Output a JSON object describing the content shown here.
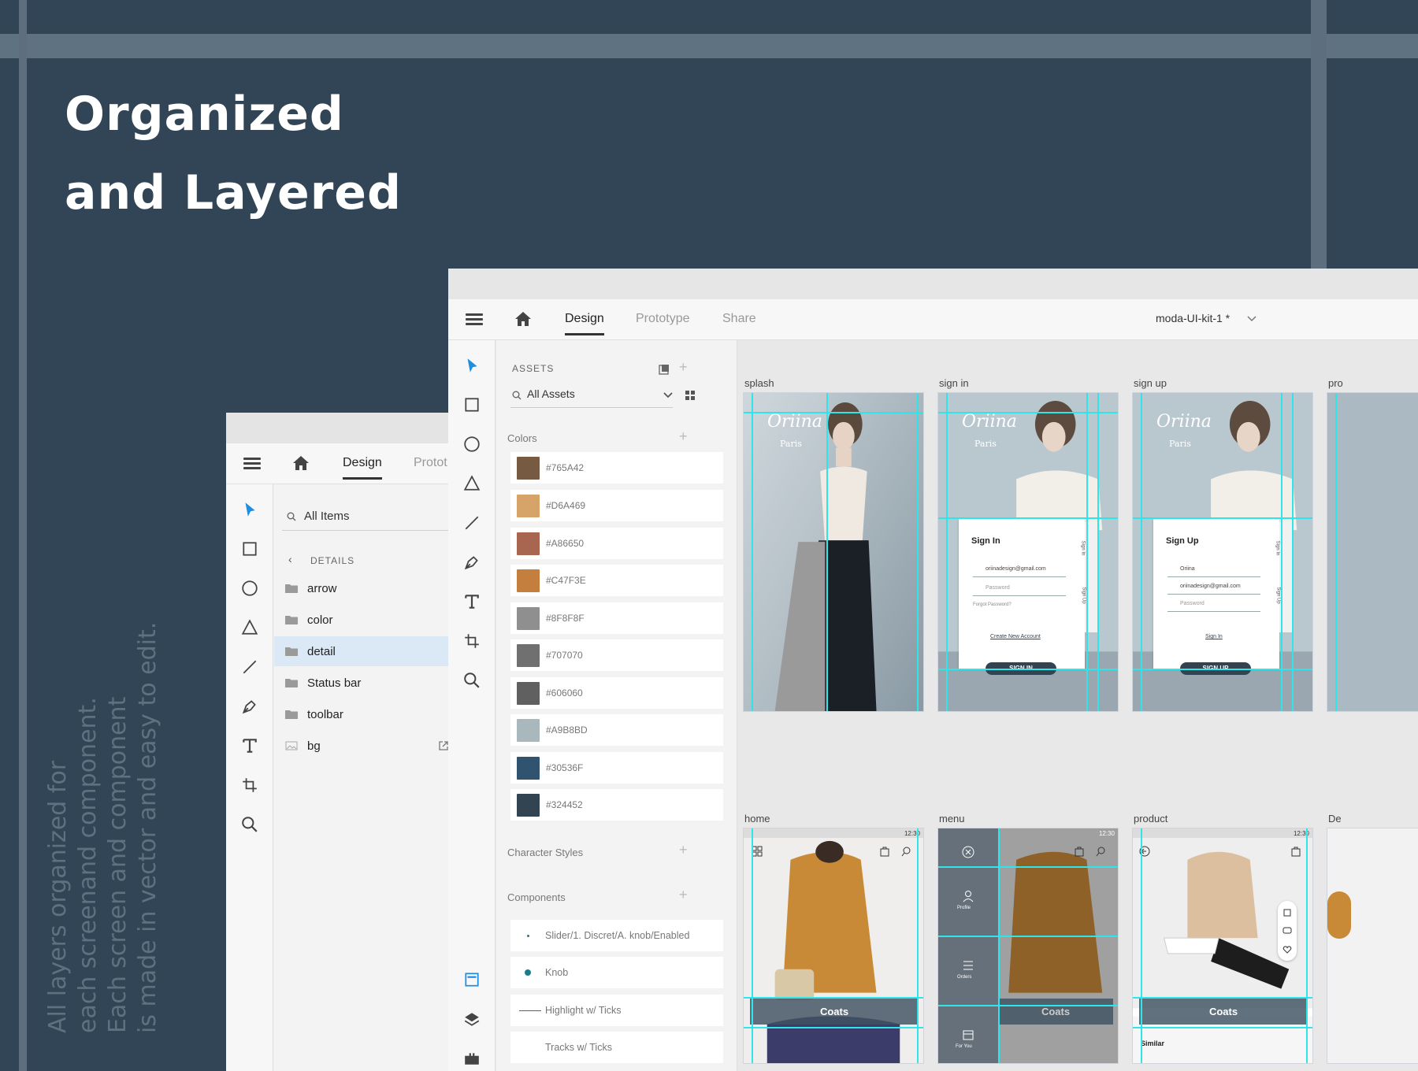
{
  "headline": {
    "line1": "Organized",
    "line2": "and Layered"
  },
  "caption": {
    "lines": [
      "All layers organized for",
      "each screenand component.",
      "Each screen and component",
      "is made in vector and easy to edit."
    ]
  },
  "back_window": {
    "tabs": {
      "design": "Design",
      "prototype": "Protot"
    },
    "search_label": "All Items",
    "details_label": "DETAILS",
    "items": [
      {
        "label": "arrow",
        "icon": "folder-icon"
      },
      {
        "label": "color",
        "icon": "folder-icon"
      },
      {
        "label": "detail",
        "icon": "folder-icon",
        "selected": true
      },
      {
        "label": "Status bar",
        "icon": "folder-icon"
      },
      {
        "label": "toolbar",
        "icon": "folder-icon"
      },
      {
        "label": "bg",
        "icon": "image-icon"
      }
    ]
  },
  "front_window": {
    "tabs": {
      "design": "Design",
      "prototype": "Prototype",
      "share": "Share"
    },
    "document_title": "moda-UI-kit-1 *",
    "assets": {
      "header": "ASSETS",
      "filter": "All Assets",
      "colors_title": "Colors",
      "colors": [
        "#765A42",
        "#D6A469",
        "#A86650",
        "#C47F3E",
        "#8F8F8F",
        "#707070",
        "#606060",
        "#A9B8BD",
        "#30536F",
        "#324452"
      ],
      "character_styles_title": "Character Styles",
      "components_title": "Components",
      "components": [
        {
          "label": "Slider/1. Discret/A. knob/Enabled",
          "icon": "slider-dot-icon"
        },
        {
          "label": "Knob",
          "icon": "knob-icon"
        },
        {
          "label": "Highlight w/ Ticks",
          "icon": "line-icon"
        },
        {
          "label": "Tracks w/ Ticks",
          "icon": "none"
        }
      ]
    },
    "artboards": {
      "splash": "splash",
      "sign_in": "sign in",
      "sign_up": "sign up",
      "product_cut": "pro",
      "home": "home",
      "menu": "menu",
      "product": "product",
      "detail_cut": "De"
    },
    "screens": {
      "brand": "Oriina",
      "brand_sub": "Paris",
      "sign_in": {
        "title": "Sign In",
        "email": "oriinadesign@gmail.com",
        "password": "Password",
        "forgot": "Forgot Password?",
        "create": "Create New Account",
        "button": "SIGN IN",
        "side_tab1": "Sign In",
        "side_tab2": "Sign Up"
      },
      "sign_up": {
        "title": "Sign Up",
        "name": "Oriina",
        "email": "oriinadesign@gmail.com",
        "password": "Password",
        "link": "Sign In",
        "button": "SIGN UP",
        "side_tab1": "Sign In",
        "side_tab2": "Sign Up"
      },
      "status_time": "12:30",
      "home_banner": "Coats",
      "menu_banner": "Coats",
      "menu_items": [
        "Profile",
        "Orders",
        "For You"
      ],
      "product_banner": "Coats",
      "product_similar": "Similar"
    }
  }
}
